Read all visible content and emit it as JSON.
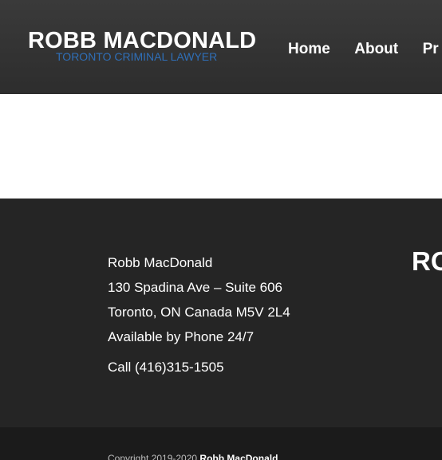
{
  "header": {
    "logo_title": "ROBB MACDONALD",
    "logo_tagline": "TORONTO CRIMINAL LAWYER",
    "nav": [
      {
        "label": "Home"
      },
      {
        "label": "About"
      },
      {
        "label": "Pr"
      }
    ]
  },
  "footer": {
    "contact": {
      "name": "Robb MacDonald",
      "address_line1": "130 Spadina Ave – Suite 606",
      "address_line2": "Toronto, ON Canada M5V 2L4",
      "availability": "Available by Phone 24/7",
      "phone": "Call (416)315-1505"
    },
    "brand_partial": "RO",
    "copyright_prefix": "Copyright 2019-2020",
    "copyright_name": "Robb MacDonald"
  },
  "colors": {
    "header_bg": "#333333",
    "tagline": "#2f6fb8",
    "footer_bg": "#252525",
    "copyright_bg": "#1b1b1b"
  }
}
